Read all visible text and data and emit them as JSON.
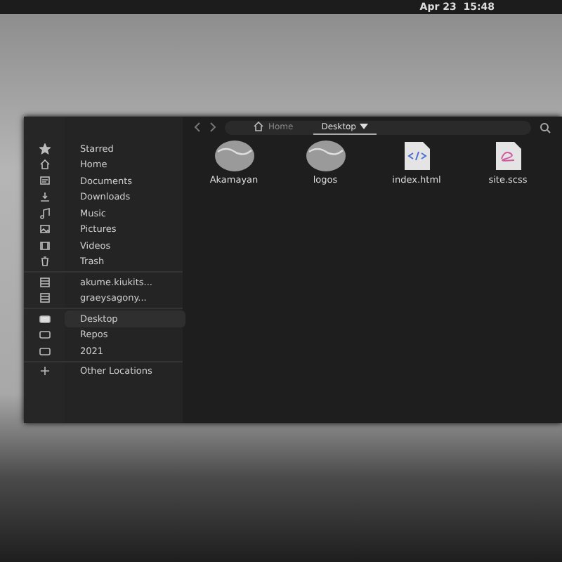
{
  "top_bar": {
    "clock": "Apr 23  15:48"
  },
  "window": {
    "path": [
      {
        "label": "Home",
        "selected": false
      },
      {
        "label": "Desktop",
        "selected": true
      }
    ],
    "sidebar": {
      "sections": [
        {
          "items": [
            {
              "label": "Starred",
              "selected": false
            },
            {
              "label": "Home",
              "selected": false
            },
            {
              "label": "Documents",
              "selected": false
            },
            {
              "label": "Downloads",
              "selected": false
            },
            {
              "label": "Music",
              "selected": false
            },
            {
              "label": "Pictures",
              "selected": false
            },
            {
              "label": "Videos",
              "selected": false
            },
            {
              "label": "Trash",
              "selected": false
            }
          ]
        },
        {
          "items": [
            {
              "label": "akume.kiukits...",
              "selected": false
            },
            {
              "label": "graeysagony...",
              "selected": false
            }
          ]
        },
        {
          "items": [
            {
              "label": "Desktop",
              "selected": true
            },
            {
              "label": "Repos",
              "selected": false
            },
            {
              "label": "2021",
              "selected": false
            }
          ]
        },
        {
          "items": [
            {
              "label": "Other Locations",
              "selected": false
            }
          ]
        }
      ]
    },
    "files": [
      {
        "name": "Akamayan",
        "kind": "folder"
      },
      {
        "name": "logos",
        "kind": "folder"
      },
      {
        "name": "index.html",
        "kind": "html"
      },
      {
        "name": "site.scss",
        "kind": "scss"
      }
    ]
  }
}
